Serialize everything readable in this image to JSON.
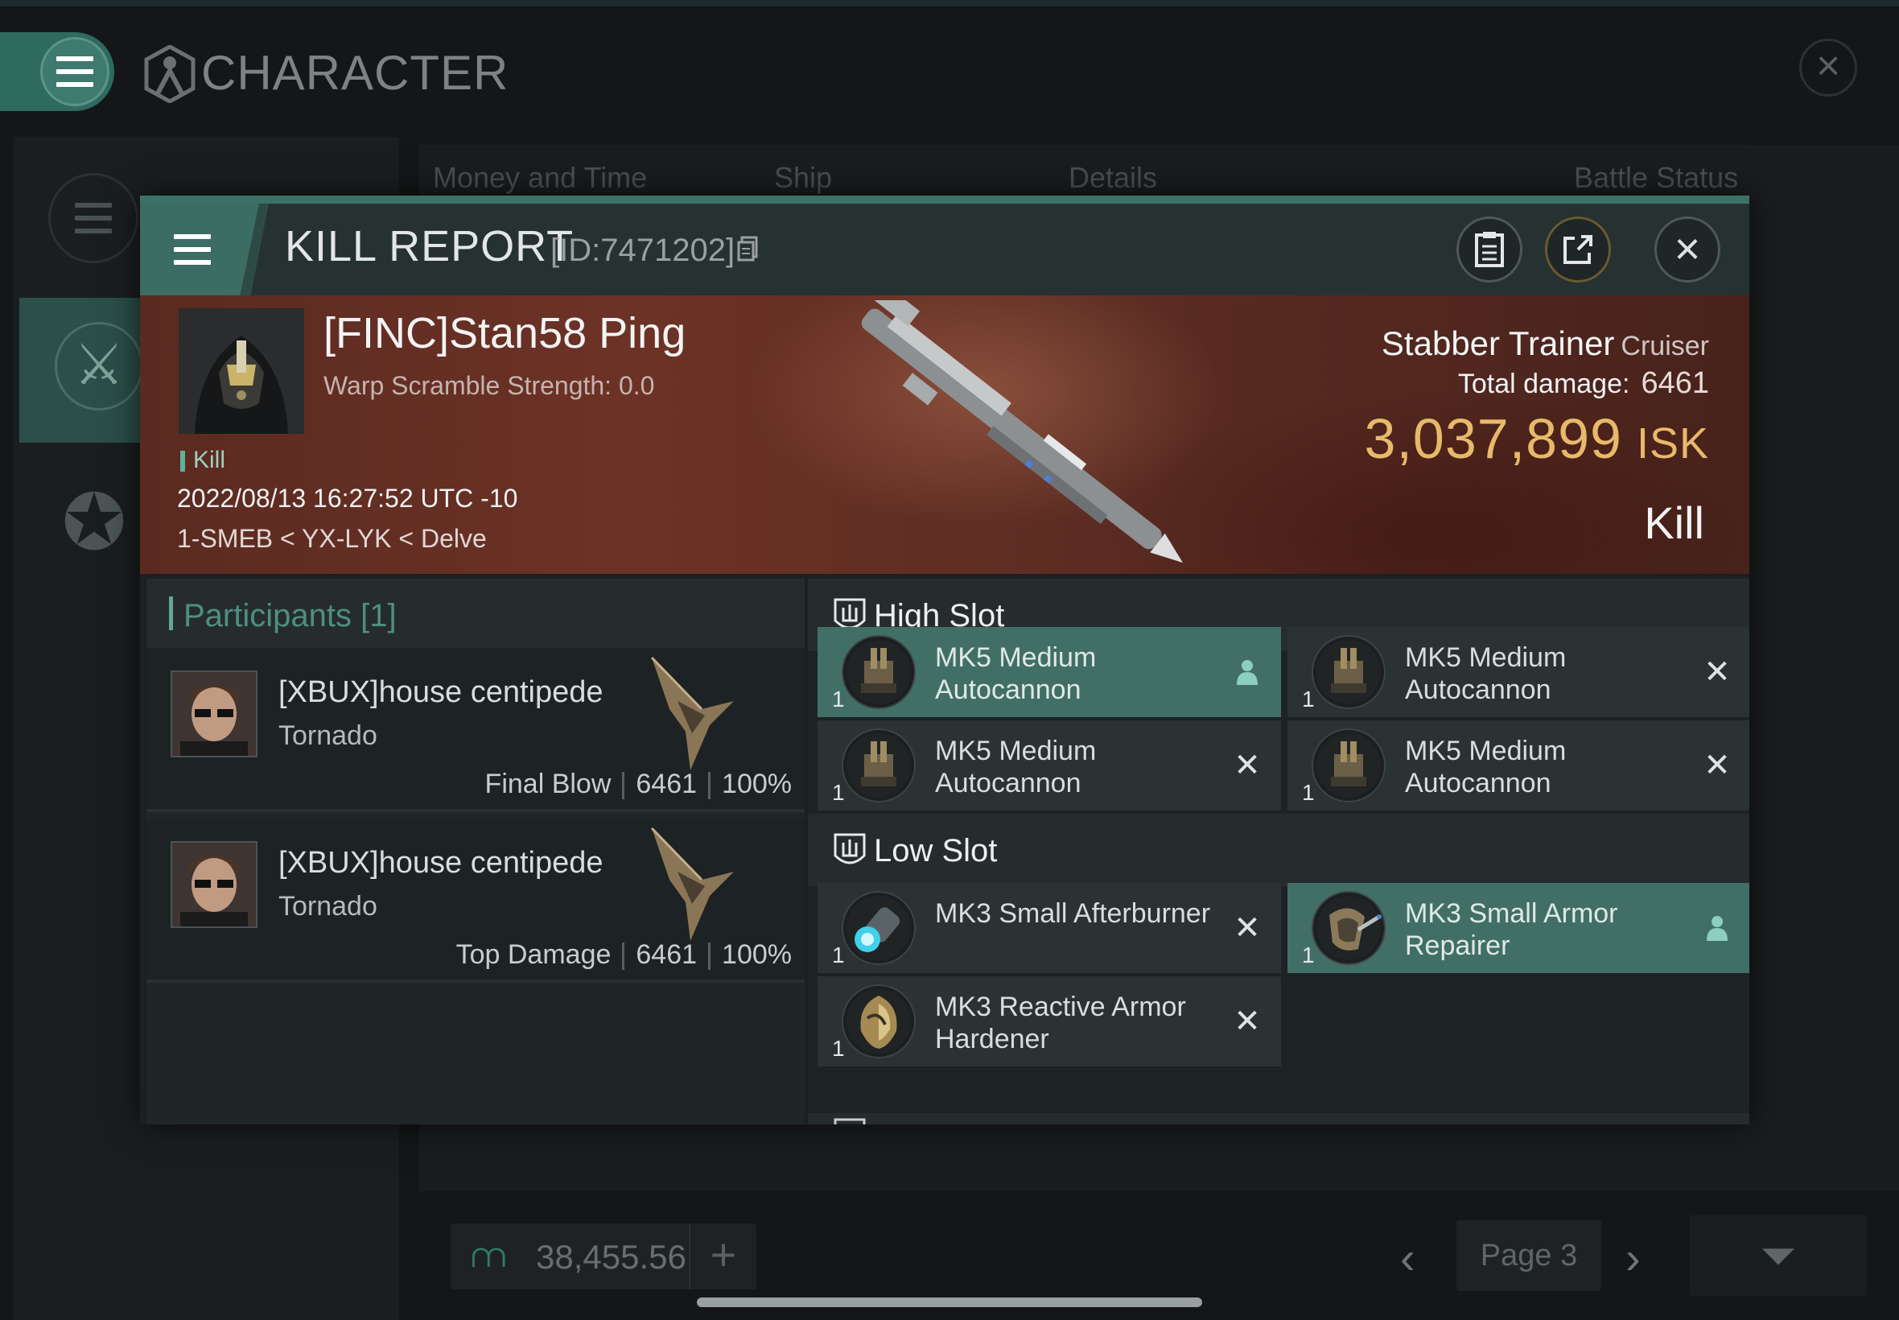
{
  "background": {
    "title": "CHARACTER",
    "columns": [
      "Money and Time",
      "Ship",
      "Details",
      "Battle Status"
    ],
    "wallet_amount": "38,455.56",
    "page_label": "Page 3"
  },
  "modal": {
    "title": "KILL REPORT",
    "id_label": "[ID:7471202]"
  },
  "victim": {
    "name": "[FINC]Stan58 Ping",
    "warp_scramble": "Warp Scramble Strength: 0.0",
    "tag": "Kill",
    "timestamp": "2022/08/13 16:27:52 UTC -10",
    "location": "1-SMEB < YX-LYK < Delve"
  },
  "ship": {
    "name": "Stabber Trainer",
    "class": "Cruiser",
    "total_damage_label": "Total damage:",
    "total_damage": "6461",
    "isk_value": "3,037,899",
    "isk_unit": "ISK",
    "result": "Kill"
  },
  "participants": {
    "title": "Participants [1]",
    "rows": [
      {
        "name": "[XBUX]house centipede",
        "ship": "Tornado",
        "role": "Final Blow",
        "damage": "6461",
        "percent": "100%"
      },
      {
        "name": "[XBUX]house centipede",
        "ship": "Tornado",
        "role": "Top Damage",
        "damage": "6461",
        "percent": "100%"
      }
    ]
  },
  "fitting": {
    "high_slot_title": "High Slot",
    "high_slot": [
      {
        "qty": "1",
        "name": "MK5 Medium Autocannon",
        "state": "pilot",
        "icon": "autocannon-icon"
      },
      {
        "qty": "1",
        "name": "MK5 Medium Autocannon",
        "state": "destroyed",
        "icon": "autocannon-icon"
      },
      {
        "qty": "1",
        "name": "MK5 Medium Autocannon",
        "state": "destroyed",
        "icon": "autocannon-icon"
      },
      {
        "qty": "1",
        "name": "MK5 Medium Autocannon",
        "state": "destroyed",
        "icon": "autocannon-icon"
      }
    ],
    "low_slot_title": "Low Slot",
    "low_slot": [
      {
        "qty": "1",
        "name": "MK3 Small Afterburner",
        "state": "destroyed",
        "icon": "afterburner-icon"
      },
      {
        "qty": "1",
        "name": "MK3 Small Armor Repairer",
        "state": "pilot",
        "icon": "armor-repairer-icon"
      },
      {
        "qty": "1",
        "name": "MK3 Reactive Armor Hardener",
        "state": "destroyed",
        "icon": "armor-hardener-icon"
      }
    ]
  },
  "colors": {
    "accent": "#3b6d62",
    "active_module": "#416f66",
    "isk_gold": "#e7b96a",
    "banner_red": "#6d3226"
  }
}
